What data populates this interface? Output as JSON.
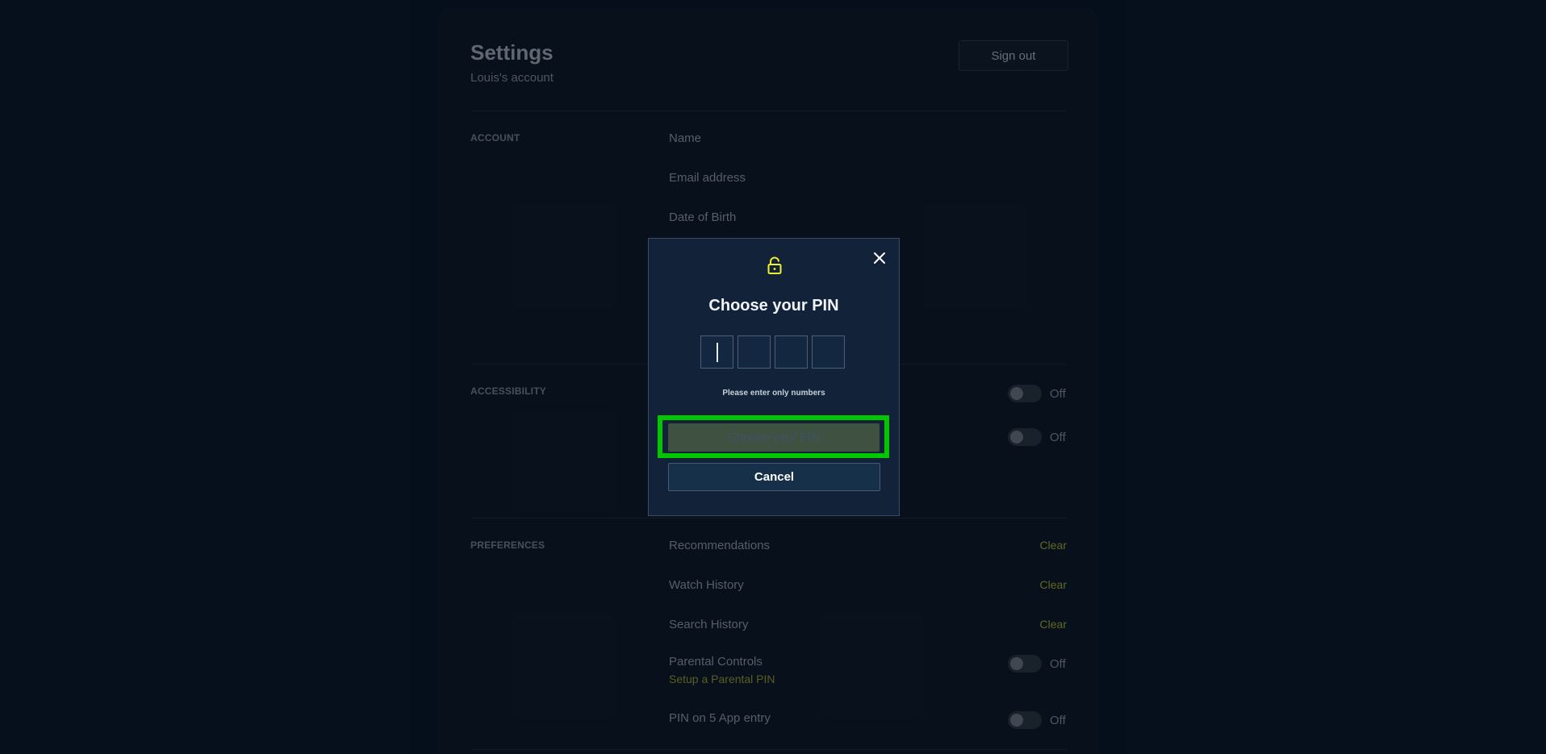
{
  "settings": {
    "title": "Settings",
    "subtitle": "Louis's account",
    "sign_out": "Sign out"
  },
  "account": {
    "section": "ACCOUNT",
    "fields": [
      "Name",
      "Email address",
      "Date of Birth"
    ]
  },
  "accessibility": {
    "section": "ACCESSIBILITY",
    "toggles": [
      "Off",
      "Off"
    ]
  },
  "preferences": {
    "section": "PREFERENCES",
    "items": [
      {
        "label": "Recommendations",
        "action": "Clear"
      },
      {
        "label": "Watch History",
        "action": "Clear"
      },
      {
        "label": "Search History",
        "action": "Clear"
      },
      {
        "label": "Parental Controls",
        "toggle": "Off",
        "link": "Setup a Parental PIN"
      },
      {
        "label": "PIN on 5 App entry",
        "toggle": "Off"
      }
    ]
  },
  "modal": {
    "title": "Choose your PIN",
    "helper": "Please enter only numbers",
    "primary_button": "Choose your PIN",
    "cancel_button": "Cancel",
    "pin_slots": [
      "",
      "",
      "",
      ""
    ]
  },
  "colors": {
    "accent": "#9aa12c",
    "highlight": "#00c700",
    "modal_bg": "#112239"
  }
}
